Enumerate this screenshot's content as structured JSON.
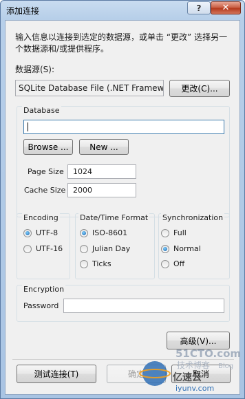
{
  "window": {
    "title": "添加连接"
  },
  "description": "输入信息以连接到选定的数据源，或单击 “更改” 选择另一个数据源和/或提供程序。",
  "datasource": {
    "label": "数据源(S):",
    "value": "SQLite Database File (.NET Framewc",
    "change_button": "更改(C)..."
  },
  "database": {
    "group_label": "Database",
    "path_value": "",
    "browse_button": "Browse ...",
    "new_button": "New ...",
    "page_size_label": "Page Size",
    "page_size_value": "1024",
    "cache_size_label": "Cache Size",
    "cache_size_value": "2000"
  },
  "encoding": {
    "label": "Encoding",
    "options": [
      {
        "label": "UTF-8",
        "selected": true
      },
      {
        "label": "UTF-16",
        "selected": false
      }
    ]
  },
  "datetime": {
    "label": "Date/Time Format",
    "options": [
      {
        "label": "ISO-8601",
        "selected": true
      },
      {
        "label": "Julian Day",
        "selected": false
      },
      {
        "label": "Ticks",
        "selected": false
      }
    ]
  },
  "sync": {
    "label": "Synchronization",
    "options": [
      {
        "label": "Full",
        "selected": false
      },
      {
        "label": "Normal",
        "selected": true
      },
      {
        "label": "Off",
        "selected": false
      }
    ]
  },
  "encryption": {
    "label": "Encryption",
    "password_label": "Password",
    "password_value": ""
  },
  "buttons": {
    "advanced": "高级(V)...",
    "test": "测试连接(T)",
    "ok": "确定",
    "cancel": "取消"
  },
  "watermark": {
    "line1": "51CTO.com",
    "line2": "技术博客",
    "line3": "Blog",
    "line4": "亿速云",
    "line5": "iyunv.com"
  }
}
